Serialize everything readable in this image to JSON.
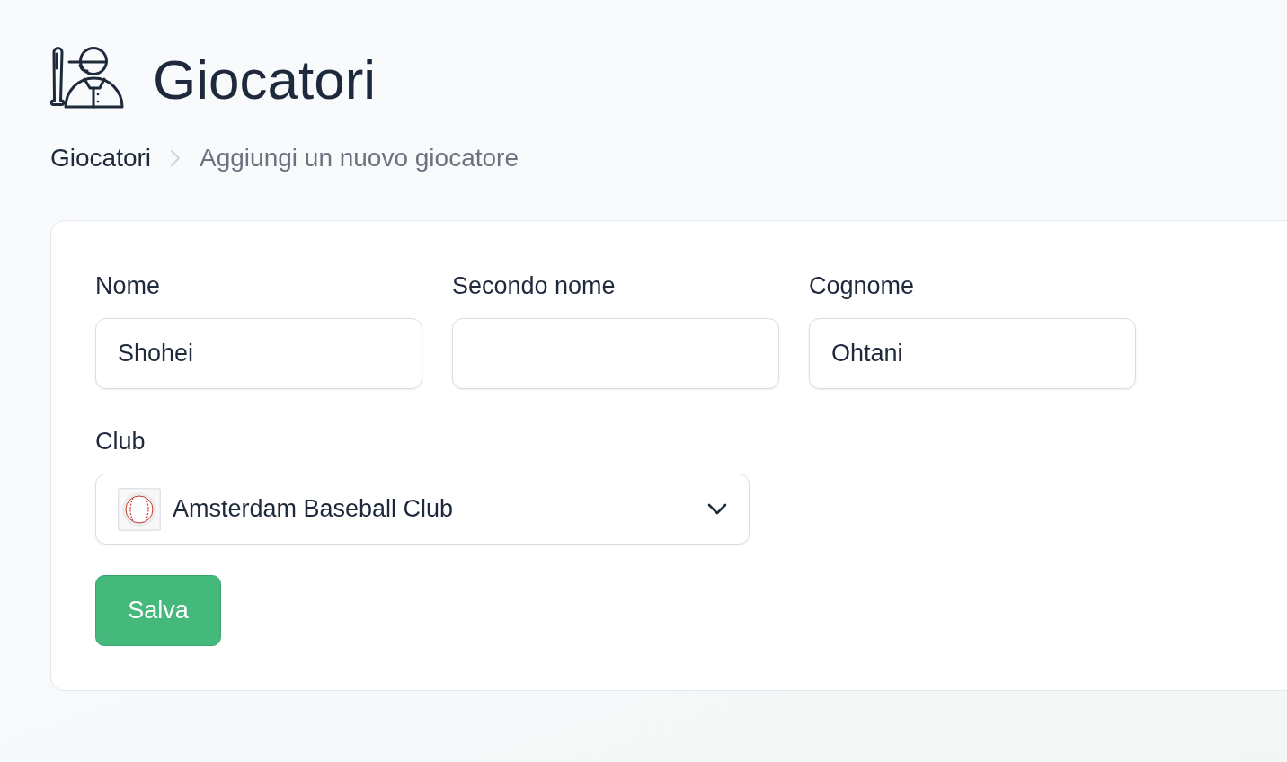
{
  "header": {
    "title": "Giocatori"
  },
  "breadcrumb": [
    {
      "label": "Giocatori",
      "current": false
    },
    {
      "label": "Aggiungi un nuovo giocatore",
      "current": true
    }
  ],
  "form": {
    "fields": [
      {
        "label": "Nome",
        "value": "Shohei"
      },
      {
        "label": "Secondo nome"
      },
      {
        "label": "Cognome",
        "value": "Ohtani"
      }
    ],
    "club": {
      "label": "Club",
      "value": "Amsterdam Baseball Club"
    },
    "submit": {
      "label": "Salva"
    }
  }
}
